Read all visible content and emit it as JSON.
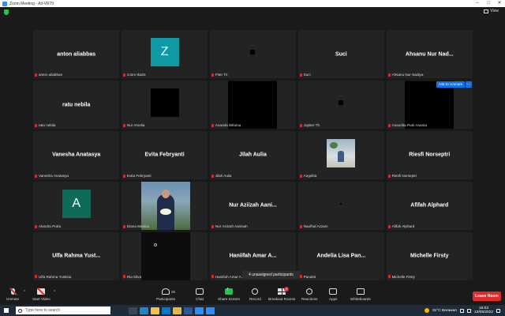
{
  "window": {
    "title": "Zoom Meeting - Alt-VR70",
    "minimize": "–",
    "maximize": "□",
    "close": "✕"
  },
  "top": {
    "view_label": "View"
  },
  "tiles": [
    {
      "display_name": "anton aliabbas",
      "label": "anton aliabbas",
      "kind": "name"
    },
    {
      "display_name": "",
      "label": "zoom Ika04",
      "kind": "avatar",
      "initial": "Z",
      "color": "#0f9aa6"
    },
    {
      "display_name": "",
      "label": "Fiter Tri",
      "kind": "dot"
    },
    {
      "display_name": "Suci",
      "label": "Suci",
      "kind": "name"
    },
    {
      "display_name": "Ahsanu Nur Nad...",
      "label": "Ahsanu Nur Nadiya",
      "kind": "name"
    },
    {
      "display_name": "ratu nebila",
      "label": "ratu nebila",
      "kind": "name"
    },
    {
      "display_name": "",
      "label": "Nur Amelia",
      "kind": "black-sm"
    },
    {
      "display_name": "",
      "label": "Ananda Wilama",
      "kind": "black-lg"
    },
    {
      "display_name": "",
      "label": "Jupiter Th",
      "kind": "dot"
    },
    {
      "display_name": "",
      "label": "Anandita Putri Ananta",
      "kind": "black-lg"
    },
    {
      "display_name": "Vanesha Anatasya",
      "label": "Vanesha Anatasya",
      "kind": "name"
    },
    {
      "display_name": "Evita Febryanti",
      "label": "Evita Febryanti",
      "kind": "name"
    },
    {
      "display_name": "Jilah Aulia",
      "label": "Jilah Aulia",
      "kind": "name"
    },
    {
      "display_name": "",
      "label": "Angelita",
      "kind": "photo"
    },
    {
      "display_name": "Riesfi Norseptri",
      "label": "Riesfi Norseptri",
      "kind": "name"
    },
    {
      "display_name": "",
      "label": "Alandra Putra",
      "kind": "avatar",
      "initial": "A",
      "color": "#0e6b58"
    },
    {
      "display_name": "",
      "label": "Diana Monica",
      "kind": "video"
    },
    {
      "display_name": "Nur Aziizah Aani...",
      "label": "Nur Aziizah Aanisah",
      "kind": "name"
    },
    {
      "display_name": "",
      "label": "Naufhal Azzam",
      "kind": "tinydot"
    },
    {
      "display_name": "Afifah Alphard",
      "label": "Afifah Alphard",
      "kind": "name"
    },
    {
      "display_name": "Ulfa Rahma Yust...",
      "label": "Ulfa Rahma Yustisia",
      "kind": "name"
    },
    {
      "display_name": "",
      "label": "Ria Silva",
      "kind": "dark-video"
    },
    {
      "display_name": "Haniifah Amar A...",
      "label": "Haniifah Amar A...",
      "kind": "name"
    },
    {
      "display_name": "Andelia Lisa Pan...",
      "label": "Pandeti",
      "kind": "name"
    },
    {
      "display_name": "Michelle Firsty",
      "label": "Michelle Firsty",
      "kind": "name"
    }
  ],
  "ask_to_unmute": "Ask to Unmute",
  "more_glyph": "…",
  "unassigned": "4 unassigned participants",
  "toolbar": {
    "unmute": "Unmute",
    "start_video": "Start Video",
    "participants": "Participants",
    "participants_count": "25",
    "chat": "Chat",
    "share_screen": "Share Screen",
    "record": "Record",
    "breakout_rooms": "Breakout Rooms",
    "breakout_badge": "4",
    "reactions": "Reactions",
    "apps": "Apps",
    "whiteboards": "Whiteboards",
    "leave": "Leave Room",
    "caret": "^"
  },
  "taskbar": {
    "search_placeholder": "Type here to search",
    "apps": [
      {
        "name": "task-view",
        "color": "#3a4756"
      },
      {
        "name": "edge",
        "color": "#1e88c7"
      },
      {
        "name": "file-explorer",
        "color": "#f2c14e"
      },
      {
        "name": "store",
        "color": "#0078d4"
      },
      {
        "name": "chrome",
        "color": "#e5b83a"
      },
      {
        "name": "word",
        "color": "#2b579a"
      },
      {
        "name": "zoom",
        "color": "#2d8cff"
      },
      {
        "name": "zoom-2",
        "color": "#2d8cff"
      }
    ],
    "weather": "31°C Berawan",
    "time": "16:03",
    "date": "13/05/2022"
  }
}
